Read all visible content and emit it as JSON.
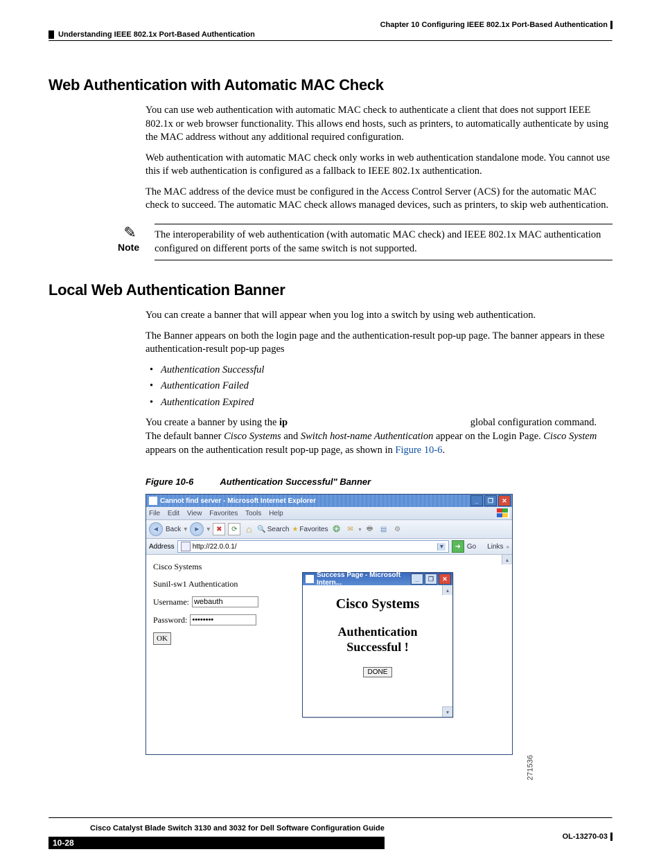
{
  "header": {
    "chapter_line": "Chapter 10    Configuring IEEE 802.1x Port-Based Authentication",
    "section_line": "Understanding IEEE 802.1x Port-Based Authentication"
  },
  "section1": {
    "title": "Web Authentication with Automatic MAC Check",
    "p1": "You can use web authentication with automatic MAC check to authenticate a client that does not support IEEE 802.1x or web browser functionality. This allows end hosts, such as printers, to automatically authenticate by using the MAC address without any additional required configuration.",
    "p2": "Web authentication with automatic MAC check only works in web authentication standalone mode. You cannot use this if web authentication is configured as a fallback to IEEE 802.1x authentication.",
    "p3": "The MAC address of the device must be configured in the Access Control Server (ACS) for the automatic MAC check to succeed. The automatic MAC check allows managed devices, such as printers, to skip web authentication.",
    "note_label": "Note",
    "note_body": "The interoperability of web authentication (with automatic MAC check) and IEEE 802.1x MAC authentication configured on different ports of the same switch is not supported."
  },
  "section2": {
    "title": "Local Web Authentication Banner",
    "p1": "You can create a banner that will appear when you log into a switch by using web authentication.",
    "p2": "The Banner appears on both the login page and the authentication-result pop-up page. The banner appears in these authentication-result pop-up pages",
    "bullets": [
      "Authentication Successful",
      "Authentication Failed",
      "Authentication Expired"
    ],
    "p3_a": "You create a banner by using the ",
    "p3_cmd": "ip",
    "p3_b": " global configuration command. The default banner ",
    "p3_em1": "Cisco Systems",
    "p3_c": " and ",
    "p3_em2": "Switch host-name Authentication",
    "p3_d": " appear on the Login Page. ",
    "p3_em3": "Cisco System",
    "p3_e": " appears on the authentication result pop-up page, as shown in ",
    "p3_link": "Figure 10-6",
    "p3_f": "."
  },
  "figure": {
    "caption_num": "Figure 10-6",
    "caption_title": "Authentication Successful\" Banner",
    "side_number": "271536",
    "main_window": {
      "title": "Cannot find server - Microsoft Internet Explorer",
      "menus": [
        "File",
        "Edit",
        "View",
        "Favorites",
        "Tools",
        "Help"
      ],
      "back_label": "Back",
      "search_label": "Search",
      "favorites_label": "Favorites",
      "address_label": "Address",
      "address_value": "http://22.0.0.1/",
      "go_label": "Go",
      "links_label": "Links",
      "content": {
        "brand": "Cisco Systems",
        "subtitle": "Sunil-sw1 Authentication",
        "username_label": "Username:",
        "username_value": "webauth",
        "password_label": "Password:",
        "password_value": "••••••••",
        "ok_label": "OK"
      }
    },
    "popup": {
      "title": "Success Page - Microsoft Intern...",
      "brand": "Cisco Systems",
      "line1": "Authentication",
      "line2": "Successful !",
      "done_label": "DONE"
    }
  },
  "footer": {
    "guide": "Cisco Catalyst Blade Switch 3130 and 3032 for Dell Software Configuration Guide",
    "page": "10-28",
    "doc_id": "OL-13270-03"
  }
}
